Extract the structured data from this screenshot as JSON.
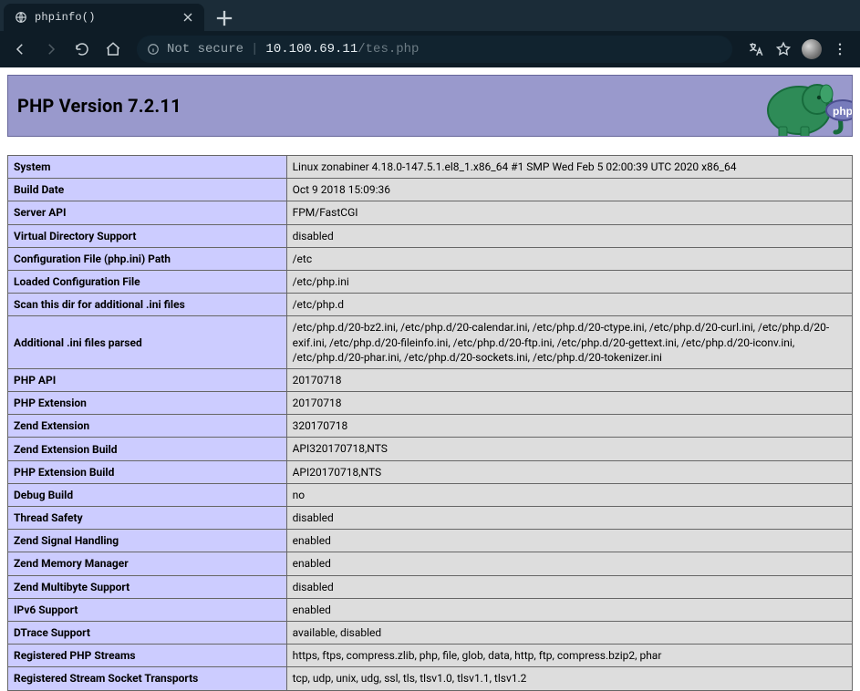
{
  "browser": {
    "tab_title": "phpinfo()",
    "not_secure_label": "Not secure",
    "url_host": "10.100.69.11",
    "url_path": "/tes.php"
  },
  "header": {
    "title": "PHP Version 7.2.11"
  },
  "rows": [
    {
      "k": "System",
      "v": "Linux zonabiner 4.18.0-147.5.1.el8_1.x86_64 #1 SMP Wed Feb 5 02:00:39 UTC 2020 x86_64"
    },
    {
      "k": "Build Date",
      "v": "Oct 9 2018 15:09:36"
    },
    {
      "k": "Server API",
      "v": "FPM/FastCGI"
    },
    {
      "k": "Virtual Directory Support",
      "v": "disabled"
    },
    {
      "k": "Configuration File (php.ini) Path",
      "v": "/etc"
    },
    {
      "k": "Loaded Configuration File",
      "v": "/etc/php.ini"
    },
    {
      "k": "Scan this dir for additional .ini files",
      "v": "/etc/php.d"
    },
    {
      "k": "Additional .ini files parsed",
      "v": "/etc/php.d/20-bz2.ini, /etc/php.d/20-calendar.ini, /etc/php.d/20-ctype.ini, /etc/php.d/20-curl.ini, /etc/php.d/20-exif.ini, /etc/php.d/20-fileinfo.ini, /etc/php.d/20-ftp.ini, /etc/php.d/20-gettext.ini, /etc/php.d/20-iconv.ini, /etc/php.d/20-phar.ini, /etc/php.d/20-sockets.ini, /etc/php.d/20-tokenizer.ini"
    },
    {
      "k": "PHP API",
      "v": "20170718"
    },
    {
      "k": "PHP Extension",
      "v": "20170718"
    },
    {
      "k": "Zend Extension",
      "v": "320170718"
    },
    {
      "k": "Zend Extension Build",
      "v": "API320170718,NTS"
    },
    {
      "k": "PHP Extension Build",
      "v": "API20170718,NTS"
    },
    {
      "k": "Debug Build",
      "v": "no"
    },
    {
      "k": "Thread Safety",
      "v": "disabled"
    },
    {
      "k": "Zend Signal Handling",
      "v": "enabled"
    },
    {
      "k": "Zend Memory Manager",
      "v": "enabled"
    },
    {
      "k": "Zend Multibyte Support",
      "v": "disabled"
    },
    {
      "k": "IPv6 Support",
      "v": "enabled"
    },
    {
      "k": "DTrace Support",
      "v": "available, disabled"
    },
    {
      "k": "Registered PHP Streams",
      "v": "https, ftps, compress.zlib, php, file, glob, data, http, ftp, compress.bzip2, phar"
    },
    {
      "k": "Registered Stream Socket Transports",
      "v": "tcp, udp, unix, udg, ssl, tls, tlsv1.0, tlsv1.1, tlsv1.2"
    }
  ]
}
